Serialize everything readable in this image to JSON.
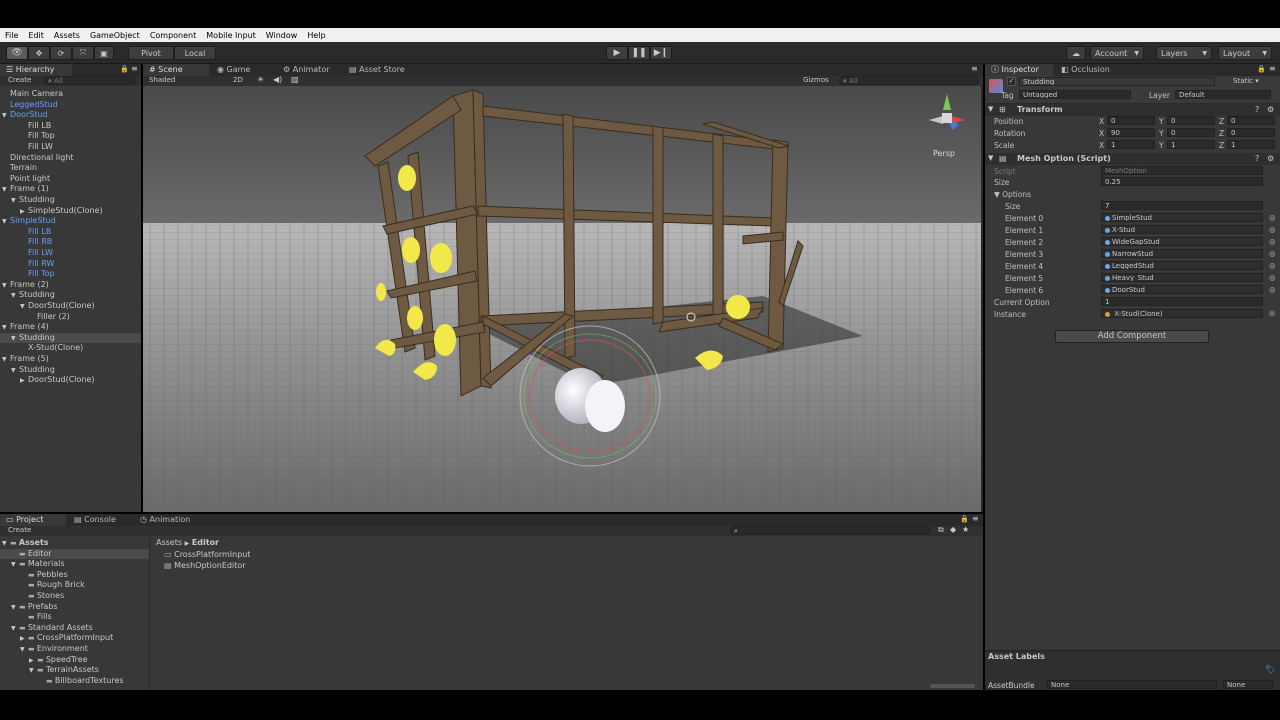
{
  "menu": [
    "File",
    "Edit",
    "Assets",
    "GameObject",
    "Component",
    "Mobile Input",
    "Window",
    "Help"
  ],
  "toolbar": {
    "pivot": "Pivot",
    "local": "Local",
    "account": "Account",
    "layers": "Layers",
    "layout": "Layout"
  },
  "hierarchy": {
    "tab": "Hierarchy",
    "create": "Create",
    "search_placeholder": "All",
    "items": [
      {
        "label": "Main Camera",
        "indent": 0,
        "color": "normal",
        "arrow": ""
      },
      {
        "label": "LeggedStud",
        "indent": 0,
        "color": "blue",
        "arrow": ""
      },
      {
        "label": "DoorStud",
        "indent": 0,
        "color": "blue",
        "arrow": "▼"
      },
      {
        "label": "Fill LB",
        "indent": 2,
        "color": "normal",
        "arrow": ""
      },
      {
        "label": "Fill Top",
        "indent": 2,
        "color": "normal",
        "arrow": ""
      },
      {
        "label": "Fill LW",
        "indent": 2,
        "color": "normal",
        "arrow": ""
      },
      {
        "label": "Directional light",
        "indent": 0,
        "color": "normal",
        "arrow": ""
      },
      {
        "label": "Terrain",
        "indent": 0,
        "color": "normal",
        "arrow": ""
      },
      {
        "label": "Point light",
        "indent": 0,
        "color": "normal",
        "arrow": ""
      },
      {
        "label": "Frame (1)",
        "indent": 0,
        "color": "normal",
        "arrow": "▼"
      },
      {
        "label": "Studding",
        "indent": 1,
        "color": "normal",
        "arrow": "▼"
      },
      {
        "label": "SimpleStud(Clone)",
        "indent": 2,
        "color": "normal",
        "arrow": "▶"
      },
      {
        "label": "SimpleStud",
        "indent": 0,
        "color": "blue",
        "arrow": "▼"
      },
      {
        "label": "Fill LB",
        "indent": 2,
        "color": "blue",
        "arrow": ""
      },
      {
        "label": "Fill RB",
        "indent": 2,
        "color": "blue",
        "arrow": ""
      },
      {
        "label": "Fill LW",
        "indent": 2,
        "color": "blue",
        "arrow": ""
      },
      {
        "label": "Fill RW",
        "indent": 2,
        "color": "blue",
        "arrow": ""
      },
      {
        "label": "Fill Top",
        "indent": 2,
        "color": "blue",
        "arrow": ""
      },
      {
        "label": "Frame (2)",
        "indent": 0,
        "color": "normal",
        "arrow": "▼"
      },
      {
        "label": "Studding",
        "indent": 1,
        "color": "normal",
        "arrow": "▼"
      },
      {
        "label": "DoorStud(Clone)",
        "indent": 2,
        "color": "normal",
        "arrow": "▼"
      },
      {
        "label": "Filler (2)",
        "indent": 3,
        "color": "normal",
        "arrow": ""
      },
      {
        "label": "Frame (4)",
        "indent": 0,
        "color": "normal",
        "arrow": "▼"
      },
      {
        "label": "Studding",
        "indent": 1,
        "color": "normal",
        "arrow": "▼",
        "selected": true
      },
      {
        "label": "X-Stud(Clone)",
        "indent": 2,
        "color": "normal",
        "arrow": ""
      },
      {
        "label": "Frame (5)",
        "indent": 0,
        "color": "normal",
        "arrow": "▼"
      },
      {
        "label": "Studding",
        "indent": 1,
        "color": "normal",
        "arrow": "▼"
      },
      {
        "label": "DoorStud(Clone)",
        "indent": 2,
        "color": "normal",
        "arrow": "▶"
      }
    ]
  },
  "scene": {
    "tabs": [
      "Scene",
      "Game",
      "Animator",
      "Asset Store"
    ],
    "shading": "Shaded",
    "mode_2d": "2D",
    "gizmos": "Gizmos",
    "search_placeholder": "All",
    "persp": "Persp"
  },
  "inspector": {
    "tabs": [
      "Inspector",
      "Occlusion"
    ],
    "object_name": "Studding",
    "static_label": "Static",
    "tag_label": "Tag",
    "tag_value": "Untagged",
    "layer_label": "Layer",
    "layer_value": "Default",
    "transform": {
      "title": "Transform",
      "rows": [
        {
          "label": "Position",
          "x": "0",
          "y": "0",
          "z": "0"
        },
        {
          "label": "Rotation",
          "x": "90",
          "y": "0",
          "z": "0"
        },
        {
          "label": "Scale",
          "x": "1",
          "y": "1",
          "z": "1"
        }
      ]
    },
    "mesh_option": {
      "title": "Mesh Option (Script)",
      "script_label": "Script",
      "script_value": "MeshOption",
      "size_label": "Size",
      "size_value": "0.25",
      "options_label": "Options",
      "options_size_label": "Size",
      "options_size_value": "7",
      "elements": [
        {
          "label": "Element 0",
          "value": "SimpleStud"
        },
        {
          "label": "Element 1",
          "value": "X-Stud"
        },
        {
          "label": "Element 2",
          "value": "WideGapStud"
        },
        {
          "label": "Element 3",
          "value": "NarrowStud"
        },
        {
          "label": "Element 4",
          "value": "LeggedStud"
        },
        {
          "label": "Element 5",
          "value": "Heavy_Stud"
        },
        {
          "label": "Element 6",
          "value": "DoorStud"
        }
      ],
      "current_option_label": "Current Option",
      "current_option_value": "1",
      "instance_label": "Instance",
      "instance_value": "X-Stud(Clone)"
    },
    "add_component": "Add Component",
    "asset_labels": "Asset Labels",
    "asset_bundle_label": "AssetBundle",
    "asset_bundle_value": "None",
    "asset_bundle_variant": "None"
  },
  "project": {
    "tabs": [
      "Project",
      "Console",
      "Animation"
    ],
    "create": "Create",
    "tree": [
      {
        "label": "Assets",
        "indent": 0,
        "arrow": "▼",
        "bold": true
      },
      {
        "label": "Editor",
        "indent": 1,
        "arrow": "",
        "selected": true
      },
      {
        "label": "Materials",
        "indent": 1,
        "arrow": "▼"
      },
      {
        "label": "Pebbles",
        "indent": 2,
        "arrow": ""
      },
      {
        "label": "Rough Brick",
        "indent": 2,
        "arrow": ""
      },
      {
        "label": "Stones",
        "indent": 2,
        "arrow": ""
      },
      {
        "label": "Prefabs",
        "indent": 1,
        "arrow": "▼"
      },
      {
        "label": "Fills",
        "indent": 2,
        "arrow": ""
      },
      {
        "label": "Standard Assets",
        "indent": 1,
        "arrow": "▼"
      },
      {
        "label": "CrossPlatformInput",
        "indent": 2,
        "arrow": "▶"
      },
      {
        "label": "Environment",
        "indent": 2,
        "arrow": "▼"
      },
      {
        "label": "SpeedTree",
        "indent": 3,
        "arrow": "▶"
      },
      {
        "label": "TerrainAssets",
        "indent": 3,
        "arrow": "▼"
      },
      {
        "label": "BillboardTextures",
        "indent": 4,
        "arrow": ""
      }
    ],
    "breadcrumb_root": "Assets",
    "breadcrumb_sep": "▶",
    "breadcrumb_current": "Editor",
    "files": [
      "CrossPlatformInput",
      "MeshOptionEditor"
    ]
  }
}
